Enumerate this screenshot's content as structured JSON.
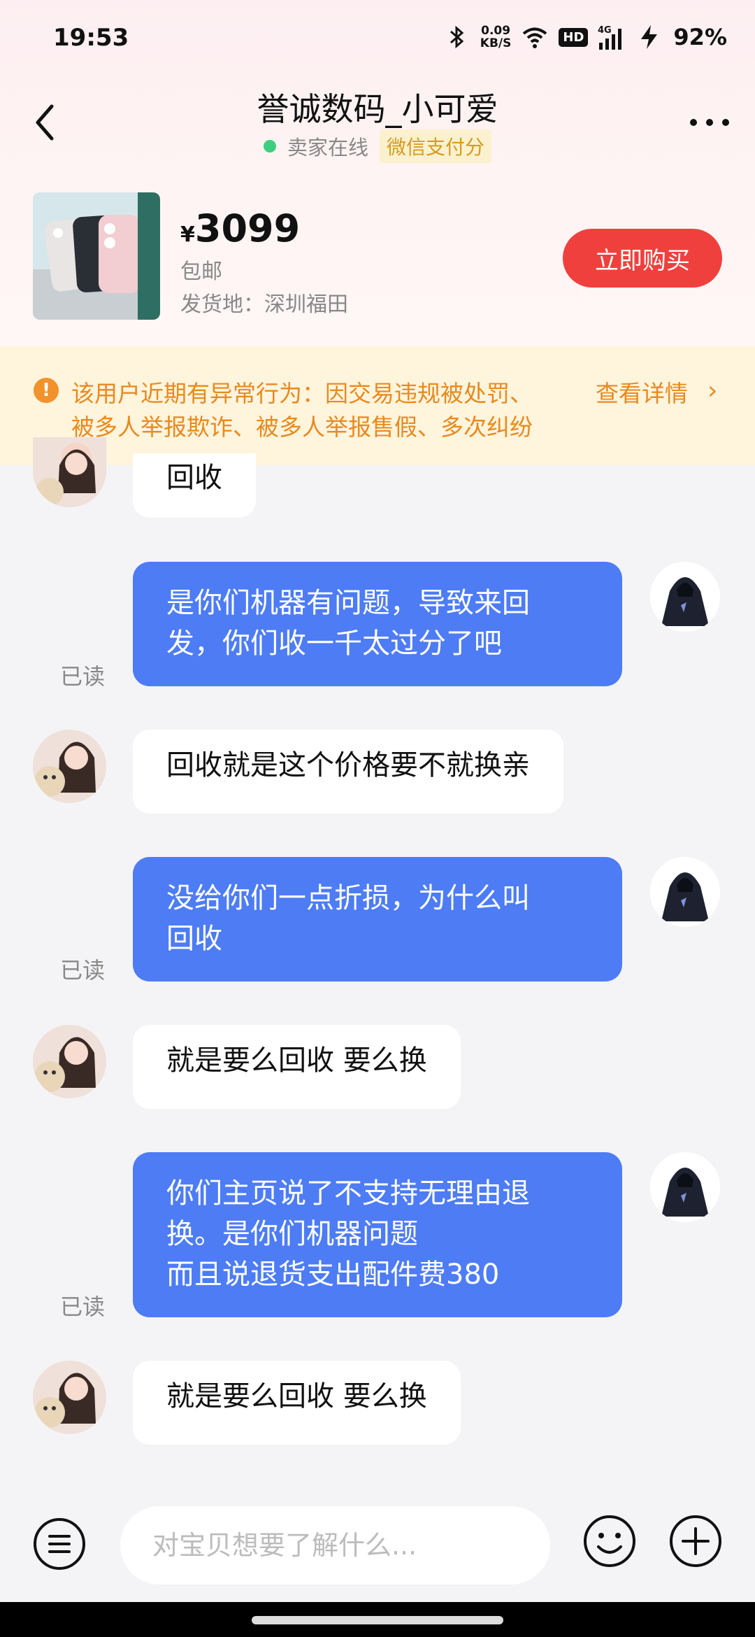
{
  "status_bar": {
    "time": "19:53",
    "net_speed_value": "0.09",
    "net_speed_unit": "KB/S",
    "hd": "HD",
    "network": "4G",
    "battery": "92%"
  },
  "header": {
    "title": "誉诚数码_小可爱",
    "online_status": "卖家在线",
    "pay_badge": "微信支付分"
  },
  "product": {
    "currency": "¥",
    "price": "3099",
    "shipping": "包邮",
    "origin": "发货地：深圳福田",
    "buy_label": "立即购买"
  },
  "warning": {
    "line1": "该用户近期有异常行为：因交易违规被处罚、",
    "line2": "被多人举报欺诈、被多人举报售假、多次纠纷",
    "link": "查看详情"
  },
  "messages": [
    {
      "from": "seller",
      "text": "回收"
    },
    {
      "from": "buyer",
      "lines": [
        "是你们机器有问题，导致来回",
        "发，你们收一千太过分了吧"
      ],
      "read": "已读"
    },
    {
      "from": "seller",
      "text": "回收就是这个价格要不就换亲"
    },
    {
      "from": "buyer",
      "lines": [
        "没给你们一点折损，为什么叫",
        "回收"
      ],
      "read": "已读"
    },
    {
      "from": "seller",
      "text": "就是要么回收  要么换"
    },
    {
      "from": "buyer",
      "lines": [
        "你们主页说了不支持无理由退",
        "换。是你们机器问题",
        "而且说退货支出配件费380"
      ],
      "read": "已读"
    },
    {
      "from": "seller",
      "text": "就是要么回收  要么换"
    }
  ],
  "input": {
    "placeholder": "对宝贝想要了解什么..."
  },
  "icons": {
    "back": "chevron-left-icon",
    "more": "more-dots-icon",
    "warning": "exclamation-icon",
    "menu": "menu-icon",
    "emoji": "emoji-icon",
    "plus": "plus-icon"
  },
  "colors": {
    "accent_blue": "#4d7cf5",
    "buy_red": "#f0403d",
    "warning_orange": "#e88a1e",
    "online_green": "#3ccf7e"
  }
}
